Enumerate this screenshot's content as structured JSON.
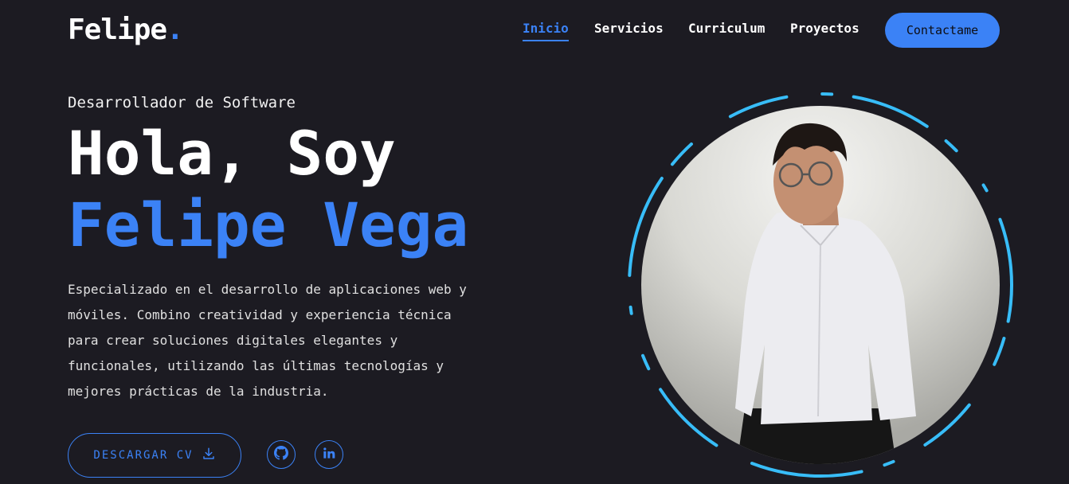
{
  "header": {
    "logo": {
      "text": "Felipe",
      "dot": "."
    },
    "nav": [
      {
        "label": "Inicio",
        "active": true
      },
      {
        "label": "Servicios",
        "active": false
      },
      {
        "label": "Curriculum",
        "active": false
      },
      {
        "label": "Proyectos",
        "active": false
      }
    ],
    "contact_label": "Contactame"
  },
  "hero": {
    "subtitle": "Desarrollador de Software",
    "greeting": "Hola, Soy",
    "name": "Felipe Vega",
    "description": "Especializado en el desarrollo de aplicaciones web y móviles. Combino creatividad y experiencia técnica para crear soluciones digitales elegantes y funcionales, utilizando las últimas tecnologías y mejores prácticas de la industria.",
    "download_cv_label": "DESCARGAR CV",
    "socials": [
      {
        "icon": "github-icon"
      },
      {
        "icon": "linkedin-icon"
      }
    ]
  },
  "colors": {
    "background": "#1c1b22",
    "accent": "#3b82f6",
    "ring": "#38bdf8"
  }
}
